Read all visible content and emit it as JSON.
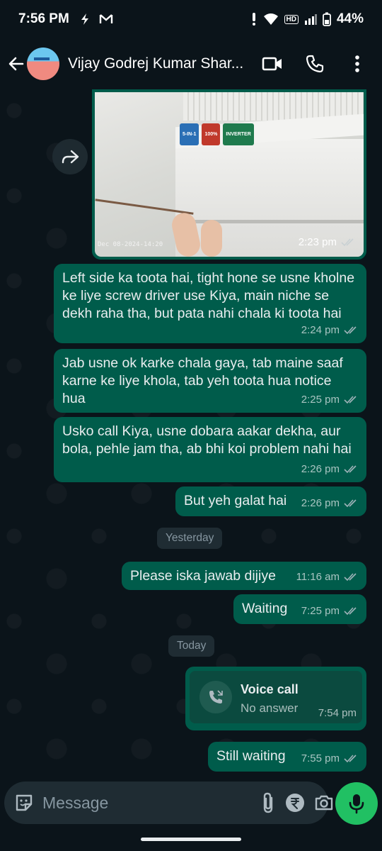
{
  "status_bar": {
    "time": "7:56 PM",
    "battery": "44%",
    "network_badge": "HD"
  },
  "header": {
    "contact_name": "Vijay Godrej Kumar Shar..."
  },
  "image_message": {
    "time": "2:23 pm",
    "stamp": "Dec 08-2024-14:20",
    "product_labels": [
      "5-IN-1",
      "100%",
      "INVERTER"
    ]
  },
  "messages": [
    {
      "text": "Left side ka toota hai, tight hone se usne kholne ke liye screw driver use Kiya, main niche se dekh raha tha, but pata nahi chala ki toota hai",
      "time": "2:24 pm"
    },
    {
      "text": "Jab usne ok karke chala gaya, tab maine saaf karne ke liye khola, tab yeh toota hua notice hua",
      "time": "2:25 pm"
    },
    {
      "text": "Usko call Kiya, usne dobara aakar dekha, aur bola, pehle jam tha, ab bhi koi problem nahi hai",
      "time": "2:26 pm"
    },
    {
      "text": "But yeh galat hai",
      "time": "2:26 pm"
    },
    {
      "text": "Please iska jawab dijiye",
      "time": "11:16 am"
    },
    {
      "text": "Waiting",
      "time": "7:25 pm"
    },
    {
      "text": "Still waiting",
      "time": "7:55 pm"
    }
  ],
  "dates": {
    "yesterday": "Yesterday",
    "today": "Today"
  },
  "voice_call": {
    "title": "Voice call",
    "status": "No answer",
    "time": "7:54 pm"
  },
  "input": {
    "placeholder": "Message"
  },
  "colors": {
    "bubble_out": "#005c4b",
    "background": "#0b141a",
    "accent": "#21c063"
  }
}
